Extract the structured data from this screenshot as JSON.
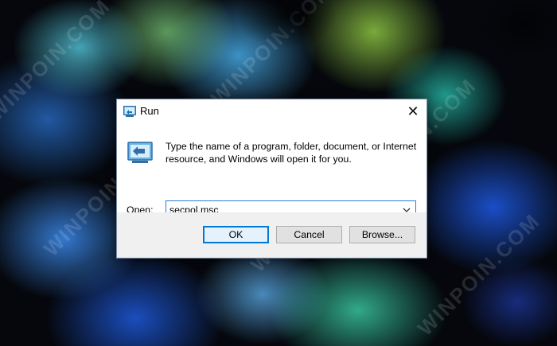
{
  "desktop": {
    "watermark_text": "WINPOIN.COM"
  },
  "dialog": {
    "title": "Run",
    "close_glyph": "✕",
    "description": "Type the name of a program, folder, document, or Internet resource, and Windows will open it for you.",
    "open_label": "Open:",
    "open_value": "secpol.msc",
    "buttons": {
      "ok": "OK",
      "cancel": "Cancel",
      "browse": "Browse..."
    },
    "icons": {
      "title": "run-icon",
      "main": "run-icon",
      "dropdown": "chevron-down-icon",
      "close": "close-icon"
    },
    "colors": {
      "accent": "#0078d7",
      "focus_border": "#2c7fd3",
      "footer_bg": "#f0f0f0",
      "button_bg": "#e1e1e1"
    }
  }
}
